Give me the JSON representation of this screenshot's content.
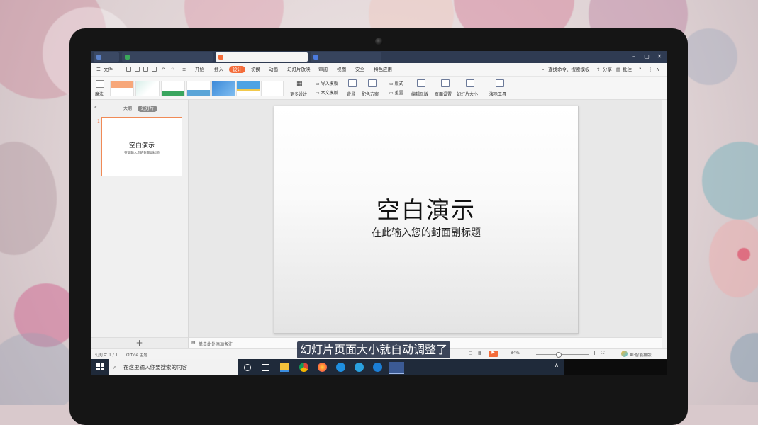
{
  "menu": {
    "file": "文件",
    "tabs": [
      "开始",
      "插入",
      "设计",
      "切换",
      "动画",
      "幻灯片放映",
      "审阅",
      "视图",
      "安全",
      "特色应用"
    ],
    "active_tab": "设计",
    "search": "查找命令、搜索模板",
    "share": "分享",
    "comment": "批注"
  },
  "ribbon": {
    "magic": "魔法",
    "more_design": "更多设计",
    "import_template": "导入模板",
    "text_template": "本文模板",
    "background": "背景",
    "color_scheme": "配色方案",
    "layout": "版式",
    "reset": "重置",
    "edit_master": "编辑母版",
    "page_setup": "页面设置",
    "slide_size": "幻灯片大小",
    "presentation_tools": "演示工具"
  },
  "panel": {
    "tab_outline": "大纲",
    "tab_slides": "幻灯片",
    "slide_number": "1",
    "thumb_title": "空白演示",
    "thumb_sub": "在此输入您的封面副标题",
    "add_symbol": "+"
  },
  "slide": {
    "title": "空白演示",
    "subtitle": "在此输入您的封面副标题"
  },
  "notes": {
    "placeholder": "单击此处添加备注"
  },
  "status": {
    "slide_count": "幻灯片 1 / 1",
    "theme": "Office 主题",
    "zoom": "84%",
    "ai": "AI·智能排版"
  },
  "taskbar": {
    "search_placeholder": "在这里输入你要搜索的内容"
  },
  "caption": "幻灯片页面大小就自动调整了",
  "colors": {
    "accent": "#f46c3a",
    "tabbar": "#2f3b52",
    "taskbar": "#1f2a3a"
  }
}
